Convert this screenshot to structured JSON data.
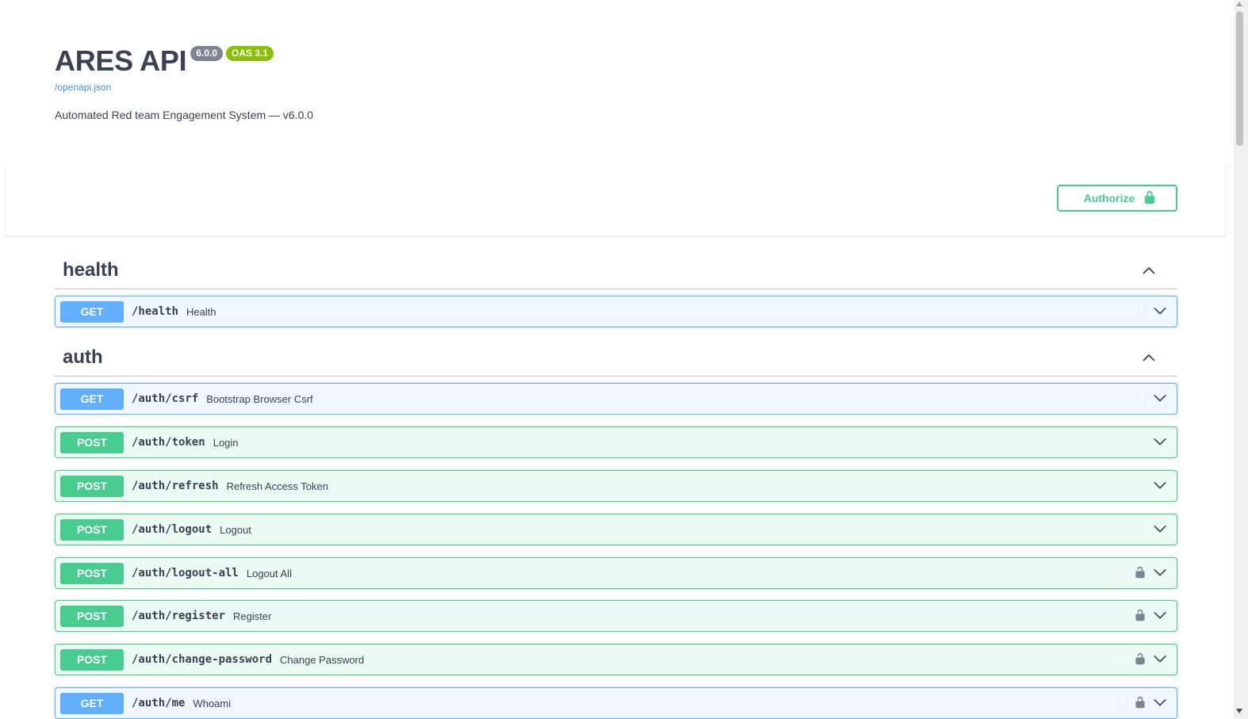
{
  "info": {
    "title": "ARES API",
    "version_badge": "6.0.0",
    "oas_badge": "OAS 3.1",
    "spec_link": "/openapi.json",
    "description": "Automated Red team Engagement System — v6.0.0"
  },
  "scheme": {
    "authorize_label": "Authorize"
  },
  "tags": [
    {
      "name": "health",
      "operations": [
        {
          "method": "GET",
          "path": "/health",
          "summary": "Health",
          "locked": false
        }
      ]
    },
    {
      "name": "auth",
      "operations": [
        {
          "method": "GET",
          "path": "/auth/csrf",
          "summary": "Bootstrap Browser Csrf",
          "locked": false
        },
        {
          "method": "POST",
          "path": "/auth/token",
          "summary": "Login",
          "locked": false
        },
        {
          "method": "POST",
          "path": "/auth/refresh",
          "summary": "Refresh Access Token",
          "locked": false
        },
        {
          "method": "POST",
          "path": "/auth/logout",
          "summary": "Logout",
          "locked": false
        },
        {
          "method": "POST",
          "path": "/auth/logout-all",
          "summary": "Logout All",
          "locked": true
        },
        {
          "method": "POST",
          "path": "/auth/register",
          "summary": "Register",
          "locked": true
        },
        {
          "method": "POST",
          "path": "/auth/change-password",
          "summary": "Change Password",
          "locked": true
        },
        {
          "method": "GET",
          "path": "/auth/me",
          "summary": "Whoami",
          "locked": true
        }
      ]
    }
  ],
  "icons": {
    "authorize": "lock-closed-icon",
    "tag_toggle": "chevron-up-icon",
    "op_toggle": "chevron-down-icon",
    "op_lock": "lock-open-icon"
  },
  "colors": {
    "get": "#61affe",
    "post": "#49cc90",
    "version_badge": "#7d8492",
    "oas_badge": "#89bf04",
    "link": "#4990e2"
  }
}
